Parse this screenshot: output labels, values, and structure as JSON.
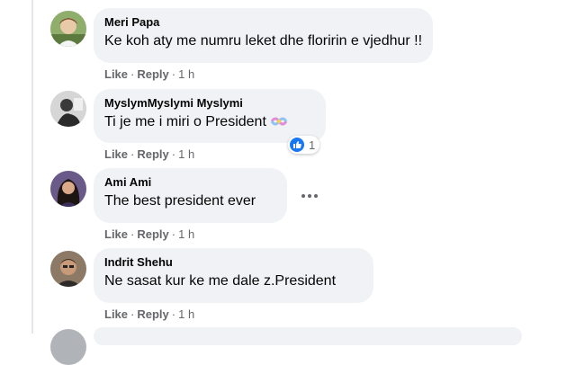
{
  "actions": {
    "like_label": "Like",
    "reply_label": "Reply",
    "separator": "·"
  },
  "comments": [
    {
      "author": "Meri Papa",
      "text": "Ke koh aty me numru leket dhe floririn e vjedhur !!",
      "time": "1 h"
    },
    {
      "author": "MyslymMyslymi Myslymi",
      "text": "Ti je me i miri o President",
      "time": "1 h",
      "reaction_count": "1"
    },
    {
      "author": "Ami Ami",
      "text": "The best president ever",
      "time": "1 h"
    },
    {
      "author": "Indrit Shehu",
      "text": "Ne sasat kur ke me dale z.President",
      "time": "1 h"
    }
  ],
  "colors": {
    "bubble_bg": "#f0f2f5",
    "meta_text": "#65676b",
    "like_blue": "#1877f2"
  }
}
